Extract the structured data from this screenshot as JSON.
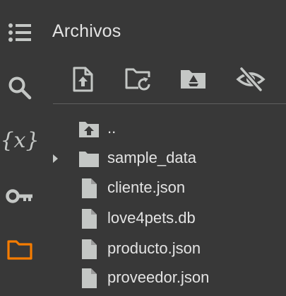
{
  "rail": {
    "items": [
      {
        "name": "table-of-contents-icon",
        "active": false
      },
      {
        "name": "search-icon",
        "active": false
      },
      {
        "name": "variables-icon",
        "label": "{x}",
        "active": false
      },
      {
        "name": "key-icon",
        "active": false
      },
      {
        "name": "folder-icon",
        "active": true
      }
    ],
    "active_color": "#f57c00",
    "icon_color": "#c4c7c5"
  },
  "panel": {
    "title": "Archivos",
    "toolbar": [
      {
        "name": "upload-file-icon"
      },
      {
        "name": "refresh-folder-icon"
      },
      {
        "name": "drive-folder-icon"
      },
      {
        "name": "hide-hidden-files-icon"
      }
    ]
  },
  "files": {
    "items": [
      {
        "label": "..",
        "type": "parent-folder"
      },
      {
        "label": "sample_data",
        "type": "folder",
        "expandable": true
      },
      {
        "label": "cliente.json",
        "type": "file"
      },
      {
        "label": "love4pets.db",
        "type": "file"
      },
      {
        "label": "producto.json",
        "type": "file"
      },
      {
        "label": "proveedor.json",
        "type": "file"
      }
    ]
  }
}
